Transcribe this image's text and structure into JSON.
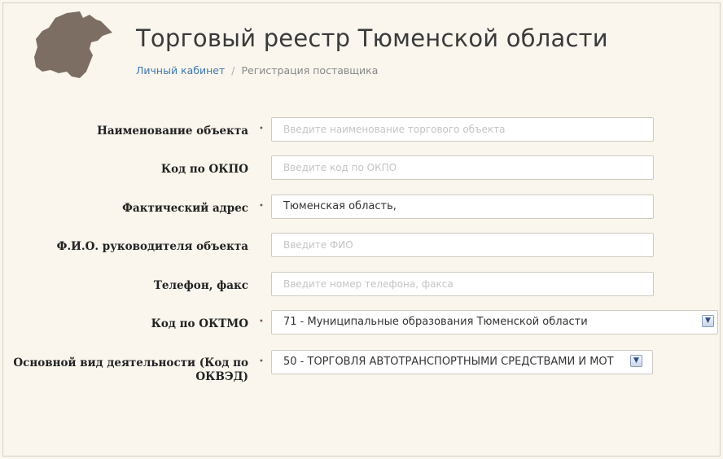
{
  "header": {
    "title": "Торговый реестр Тюменской области",
    "breadcrumb": {
      "link": "Личный кабинет",
      "separator": "/",
      "current": "Регистрация поставщика"
    },
    "logo_color": "#7d6e63"
  },
  "form": {
    "fields": [
      {
        "label": "Наименование объекта",
        "required": "•",
        "placeholder": "Введите наименование торгового объекта",
        "value": ""
      },
      {
        "label": "Код по ОКПО",
        "required": "",
        "placeholder": "Введите код по ОКПО",
        "value": ""
      },
      {
        "label": "Фактический адрес",
        "required": "•",
        "placeholder": "",
        "value": "Тюменская область,"
      },
      {
        "label": "Ф.И.О. руководителя объекта",
        "required": "",
        "placeholder": "Введите ФИО",
        "value": ""
      },
      {
        "label": "Телефон, факс",
        "required": "",
        "placeholder": "Введите номер телефона, факса",
        "value": ""
      },
      {
        "label": "Код по ОКТМО",
        "required": "•",
        "value": "71 - Муниципальные образования Тюменской области"
      },
      {
        "label": "Основной вид деятельности (Код по ОКВЭД)",
        "required": "•",
        "value": "50 - ТОРГОВЛЯ АВТОТРАНСПОРТНЫМИ СРЕДСТВАМИ И МОТ"
      }
    ]
  }
}
